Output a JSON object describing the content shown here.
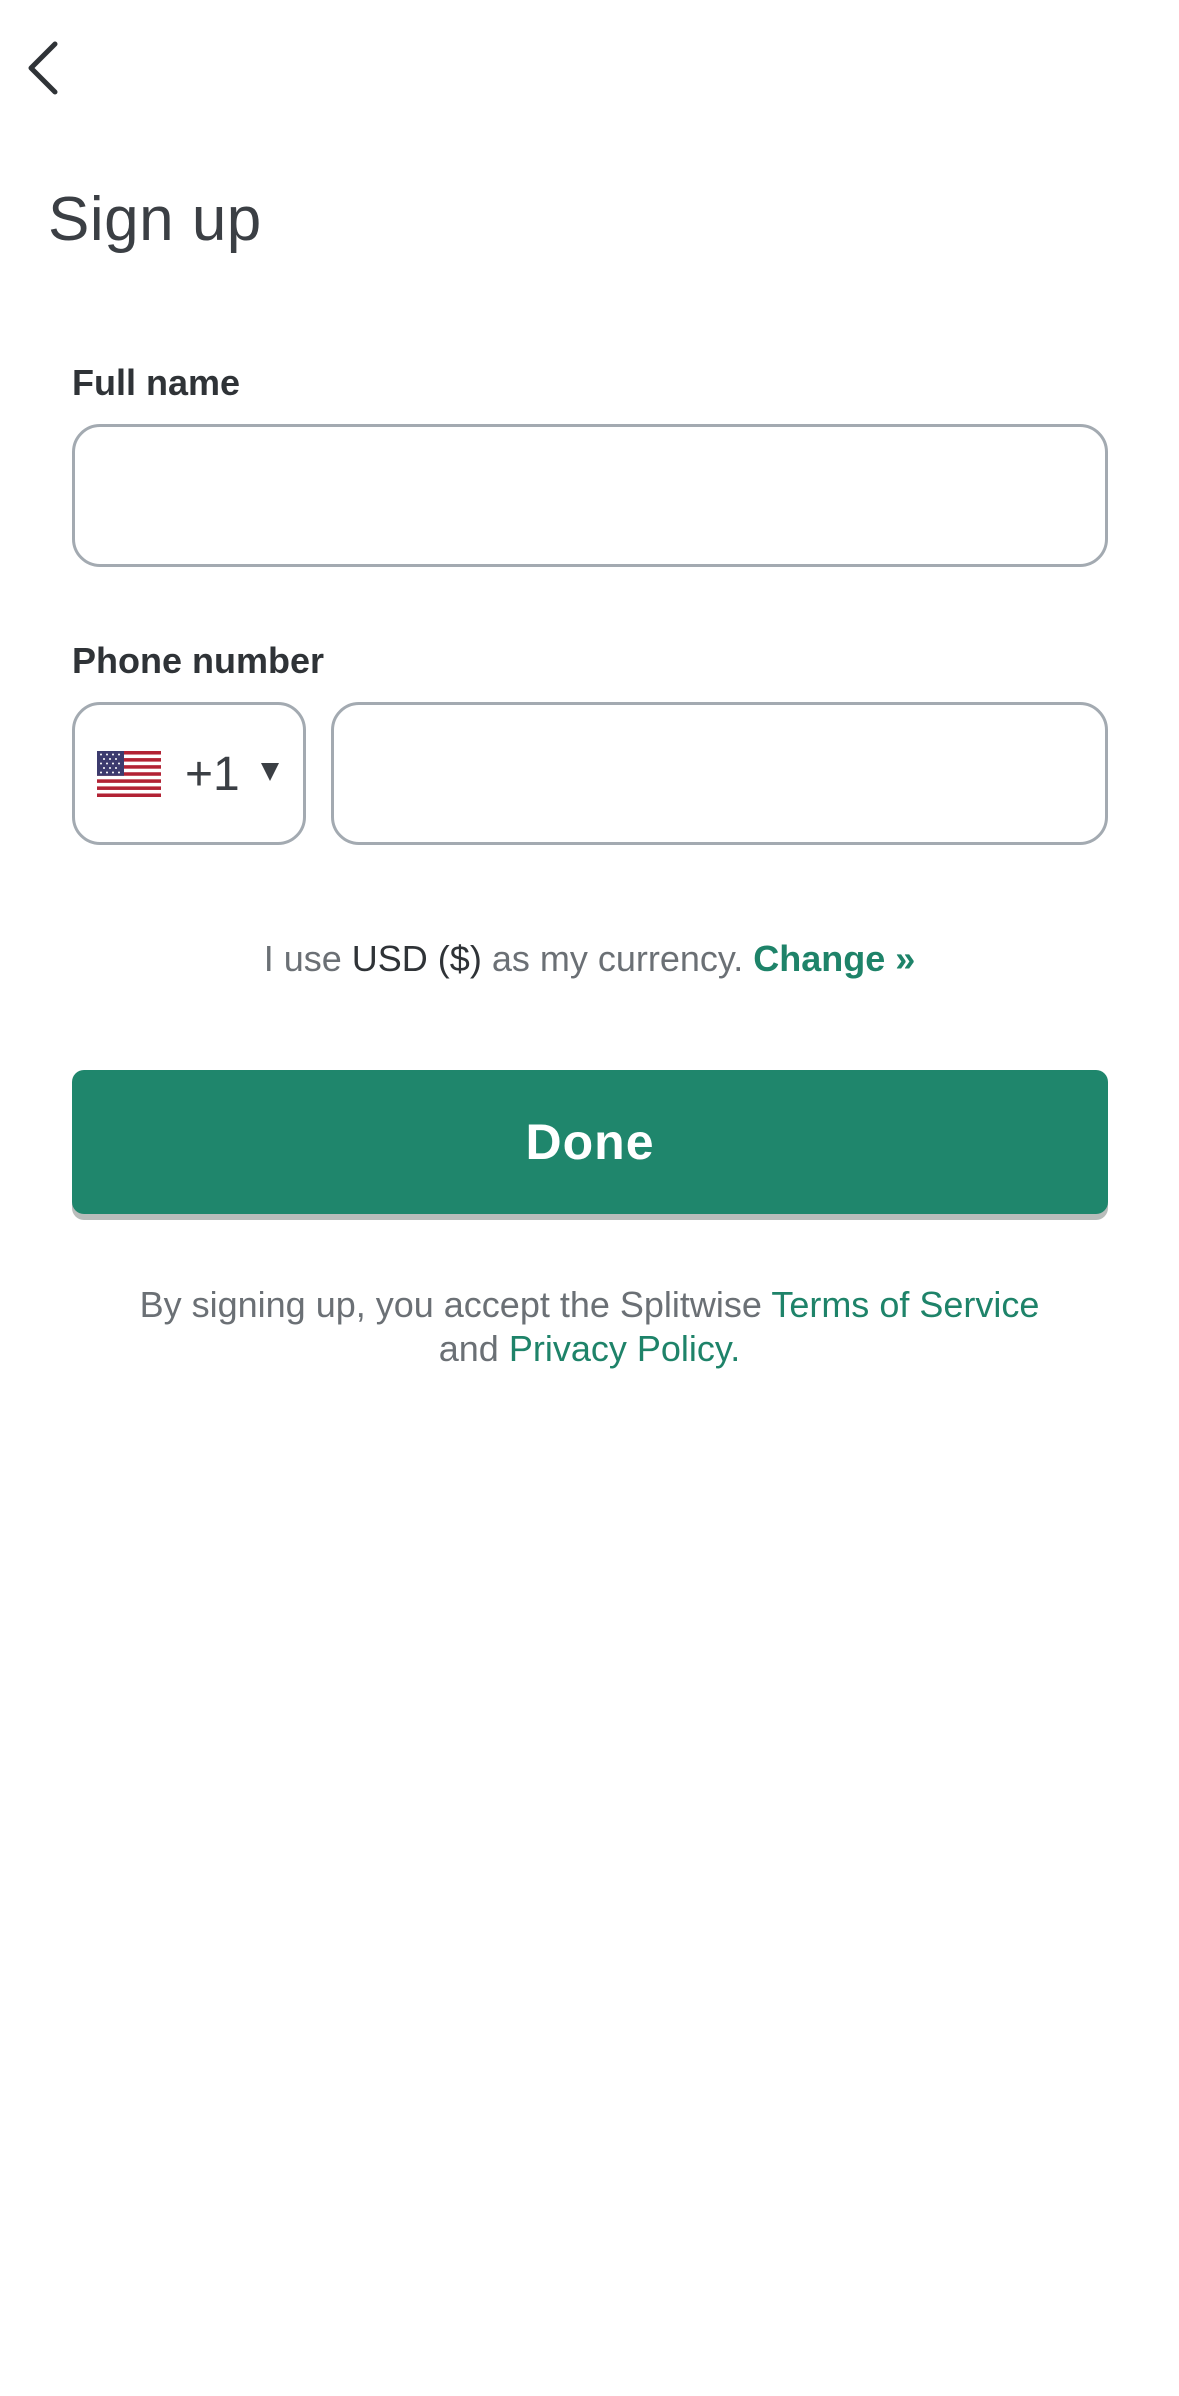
{
  "header": {
    "back_icon": "chevron-left-icon",
    "title": "Sign up"
  },
  "form": {
    "full_name_label": "Full name",
    "full_name_value": "",
    "full_name_placeholder": "",
    "phone_label": "Phone number",
    "country_flag": "us-flag-icon",
    "country_code": "+1",
    "phone_value": "",
    "phone_placeholder": ""
  },
  "currency": {
    "prefix": "I use ",
    "code": "USD ($)",
    "suffix": " as my currency. ",
    "change_label": "Change »"
  },
  "actions": {
    "done_label": "Done"
  },
  "terms": {
    "prefix": "By signing up, you accept the Splitwise ",
    "tos_label": "Terms of Service",
    "and_text": " and ",
    "privacy_label": "Privacy Policy",
    "suffix": "."
  },
  "colors": {
    "accent": "#1f866c",
    "link": "#1e8369",
    "input_border": "#a3aab1",
    "text_dark": "#2f3337",
    "text_muted": "#6b7075"
  }
}
